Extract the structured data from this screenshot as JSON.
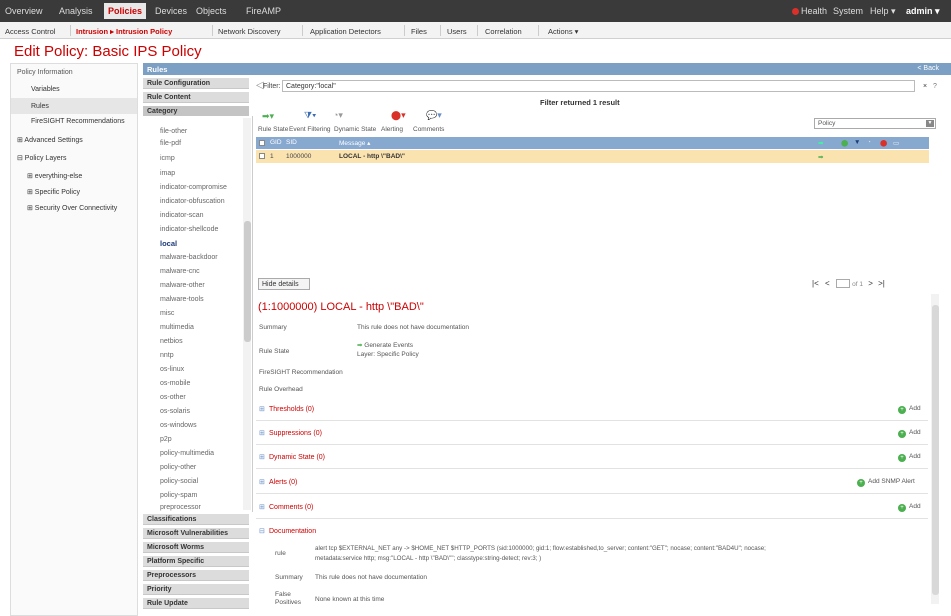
{
  "topnav": {
    "items": [
      "Overview",
      "Analysis",
      "Policies",
      "Devices",
      "Objects",
      "FireAMP"
    ],
    "health": "Health",
    "system": "System",
    "help": "Help ▾",
    "admin": "admin ▾"
  },
  "subnav": {
    "access_control": "Access Control",
    "intrusion": "Intrusion ▸ Intrusion Policy",
    "network_discovery": "Network Discovery",
    "app_detectors": "Application Detectors",
    "files": "Files",
    "users": "Users",
    "correlation": "Correlation",
    "actions": "Actions ▾"
  },
  "page_title": "Edit Policy: Basic IPS Policy",
  "left": {
    "items": [
      "Policy Information",
      "Variables",
      "Rules",
      "FireSIGHT Recommendations",
      "⊞ Advanced Settings",
      "⊟ Policy Layers",
      "⊞ everything-else",
      "⊞ Specific Policy",
      "⊞ Security Over Connectivity"
    ]
  },
  "rules_bar": {
    "title": "Rules",
    "back": "< Back"
  },
  "accordion_top": [
    "Rule Configuration",
    "Rule Content",
    "Category"
  ],
  "categories": [
    "file-other",
    "file-pdf",
    "icmp",
    "imap",
    "indicator-compromise",
    "indicator-obfuscation",
    "indicator-scan",
    "indicator-shellcode",
    "local",
    "malware-backdoor",
    "malware-cnc",
    "malware-other",
    "malware-tools",
    "misc",
    "multimedia",
    "netbios",
    "nntp",
    "os-linux",
    "os-mobile",
    "os-other",
    "os-solaris",
    "os-windows",
    "p2p",
    "policy-multimedia",
    "policy-other",
    "policy-social",
    "policy-spam",
    "preprocessor"
  ],
  "accordion_bottom": [
    "Classifications",
    "Microsoft Vulnerabilities",
    "Microsoft Worms",
    "Platform Specific",
    "Preprocessors",
    "Priority",
    "Rule Update"
  ],
  "filter": {
    "label": "Filter:",
    "value": "Category:\"local\"",
    "clear": "×",
    "help": "?",
    "result": "Filter returned 1 result"
  },
  "toolbar": {
    "rule_state": "Rule State",
    "event_filtering": "Event Filtering",
    "dynamic_state": "Dynamic State",
    "alerting": "Alerting",
    "comments": "Comments",
    "policy_select": "Policy"
  },
  "table": {
    "headers": {
      "gid": "GID",
      "sid": "SID",
      "message": "Message ▴"
    },
    "row": {
      "gid": "1",
      "sid": "1000000",
      "message": "LOCAL - http \\\"BAD\\\""
    }
  },
  "pager": {
    "hide_details": "Hide details",
    "of": "of 1"
  },
  "details": {
    "title": "(1:1000000) LOCAL - http \\\"BAD\\\"",
    "summary_label": "Summary",
    "summary_value": "This rule does not have documentation",
    "rule_state_label": "Rule State",
    "rule_state_value": "Generate Events",
    "rule_state_layer": "Layer: Specific Policy",
    "recommendation_label": "FireSIGHT Recommendation",
    "overhead_label": "Rule Overhead",
    "sections": [
      "Thresholds (0)",
      "Suppressions (0)",
      "Dynamic State (0)",
      "Alerts (0)",
      "Comments (0)"
    ],
    "add_labels": [
      "Add",
      "Add",
      "Add",
      "Add SNMP Alert",
      "Add"
    ],
    "documentation": "Documentation",
    "doc_rule_label": "rule",
    "doc_rule_text": "alert tcp $EXTERNAL_NET any -> $HOME_NET $HTTP_PORTS (sid:1000000; gid:1; flow:established,to_server; content:\"GET\"; nocase; content:\"BAD4U\"; nocase;",
    "doc_rule_text2": "metadata:service http; msg:\"LOCAL - http \\\"BAD\\\"\"; classtype:string-detect; rev:3; )",
    "doc_summary_label": "Summary",
    "doc_summary_value": "This rule does not have documentation",
    "doc_false_label": "False Positives",
    "doc_false_value": "None known at this time"
  }
}
